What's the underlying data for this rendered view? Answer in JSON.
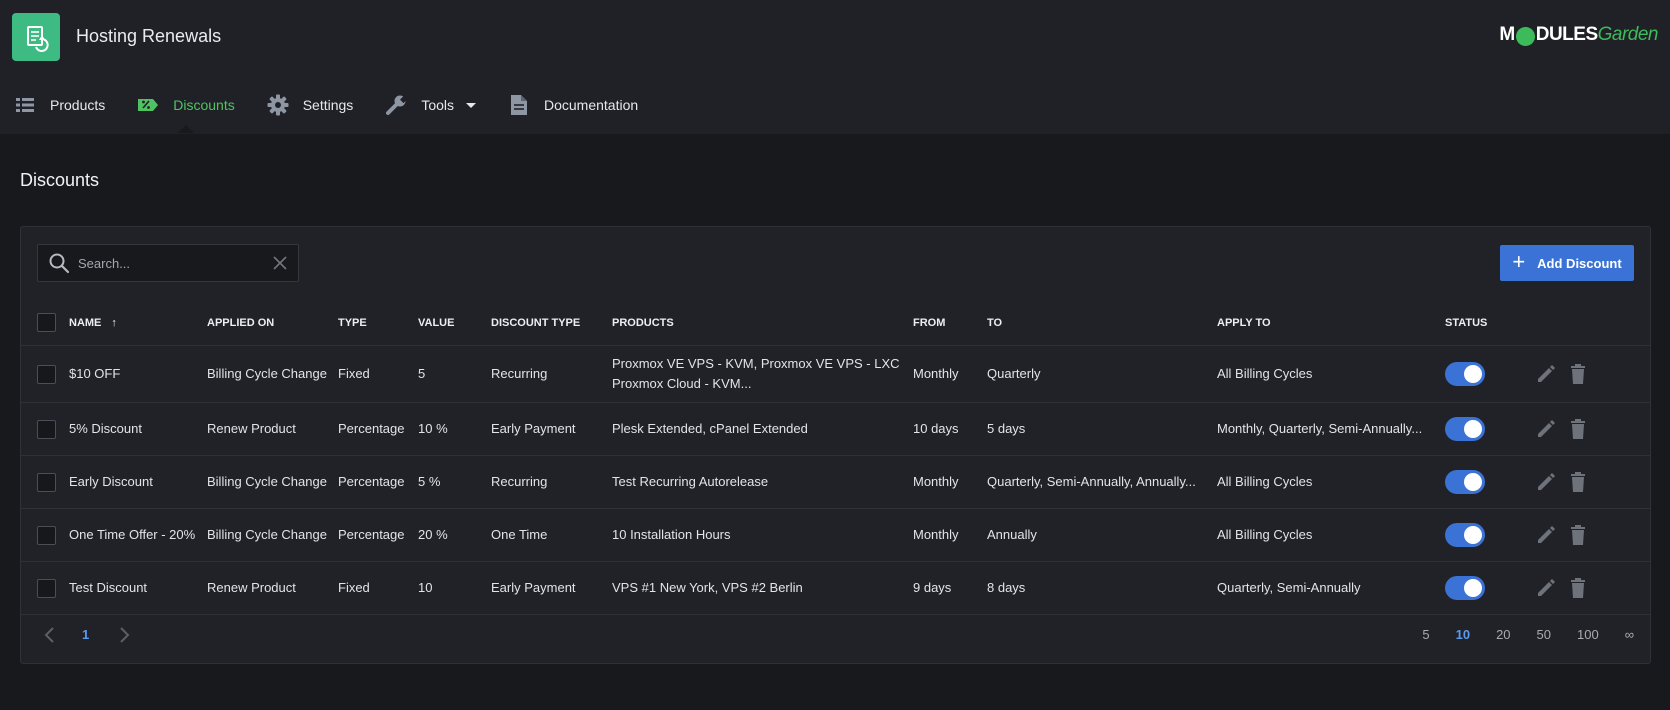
{
  "header": {
    "app_title": "Hosting Renewals",
    "logo_icon": "renewal-invoice-icon",
    "brand": {
      "left": "M",
      "middle": "DULES",
      "right": "Garden"
    }
  },
  "nav": [
    {
      "label": "Products",
      "icon": "list-icon",
      "active": false
    },
    {
      "label": "Discounts",
      "icon": "discount-tag-icon",
      "active": true
    },
    {
      "label": "Settings",
      "icon": "gear-icon",
      "active": false
    },
    {
      "label": "Tools",
      "icon": "wrench-icon",
      "active": false,
      "dropdown": true
    },
    {
      "label": "Documentation",
      "icon": "document-icon",
      "active": false
    }
  ],
  "page_title": "Discounts",
  "search": {
    "placeholder": "Search..."
  },
  "add_button": {
    "label": "Add Discount"
  },
  "table": {
    "columns": [
      "NAME",
      "APPLIED ON",
      "TYPE",
      "VALUE",
      "DISCOUNT TYPE",
      "PRODUCTS",
      "FROM",
      "TO",
      "APPLY TO",
      "STATUS"
    ],
    "sort_indicator": "↑",
    "rows": [
      {
        "name": "$10 OFF",
        "applied_on": "Billing Cycle Change",
        "type": "Fixed",
        "value": "5",
        "discount_type": "Recurring",
        "products_line1": "Proxmox VE VPS - KVM, Proxmox VE VPS - LXC",
        "products_line2": "Proxmox Cloud - KVM...",
        "from": "Monthly",
        "to": "Quarterly",
        "apply_to": "All Billing Cycles",
        "status": true
      },
      {
        "name": "5% Discount",
        "applied_on": "Renew Product",
        "type": "Percentage",
        "value": "10 %",
        "discount_type": "Early Payment",
        "products_line1": "Plesk Extended, cPanel Extended",
        "products_line2": "",
        "from": "10 days",
        "to": "5 days",
        "apply_to": "Monthly, Quarterly, Semi-Annually...",
        "status": true
      },
      {
        "name": "Early Discount",
        "applied_on": "Billing Cycle Change",
        "type": "Percentage",
        "value": "5 %",
        "discount_type": "Recurring",
        "products_line1": "Test Recurring Autorelease",
        "products_line2": "",
        "from": "Monthly",
        "to": "Quarterly, Semi-Annually, Annually...",
        "apply_to": "All Billing Cycles",
        "status": true
      },
      {
        "name": "One Time Offer - 20%",
        "applied_on": "Billing Cycle Change",
        "type": "Percentage",
        "value": "20 %",
        "discount_type": "One Time",
        "products_line1": "10 Installation Hours",
        "products_line2": "",
        "from": "Monthly",
        "to": "Annually",
        "apply_to": "All Billing Cycles",
        "status": true
      },
      {
        "name": "Test Discount",
        "applied_on": "Renew Product",
        "type": "Fixed",
        "value": "10",
        "discount_type": "Early Payment",
        "products_line1": "VPS #1 New York, VPS #2 Berlin",
        "products_line2": "",
        "from": "9 days",
        "to": "8 days",
        "apply_to": "Quarterly, Semi-Annually",
        "status": true
      }
    ]
  },
  "pagination": {
    "current_page": "1",
    "per_page_options": [
      "5",
      "10",
      "20",
      "50",
      "100",
      "∞"
    ],
    "selected_per_page": "10"
  },
  "colors": {
    "accent_green": "#4fc361",
    "primary_blue": "#3a72d6",
    "background": "#18191d",
    "panel": "#202228"
  }
}
